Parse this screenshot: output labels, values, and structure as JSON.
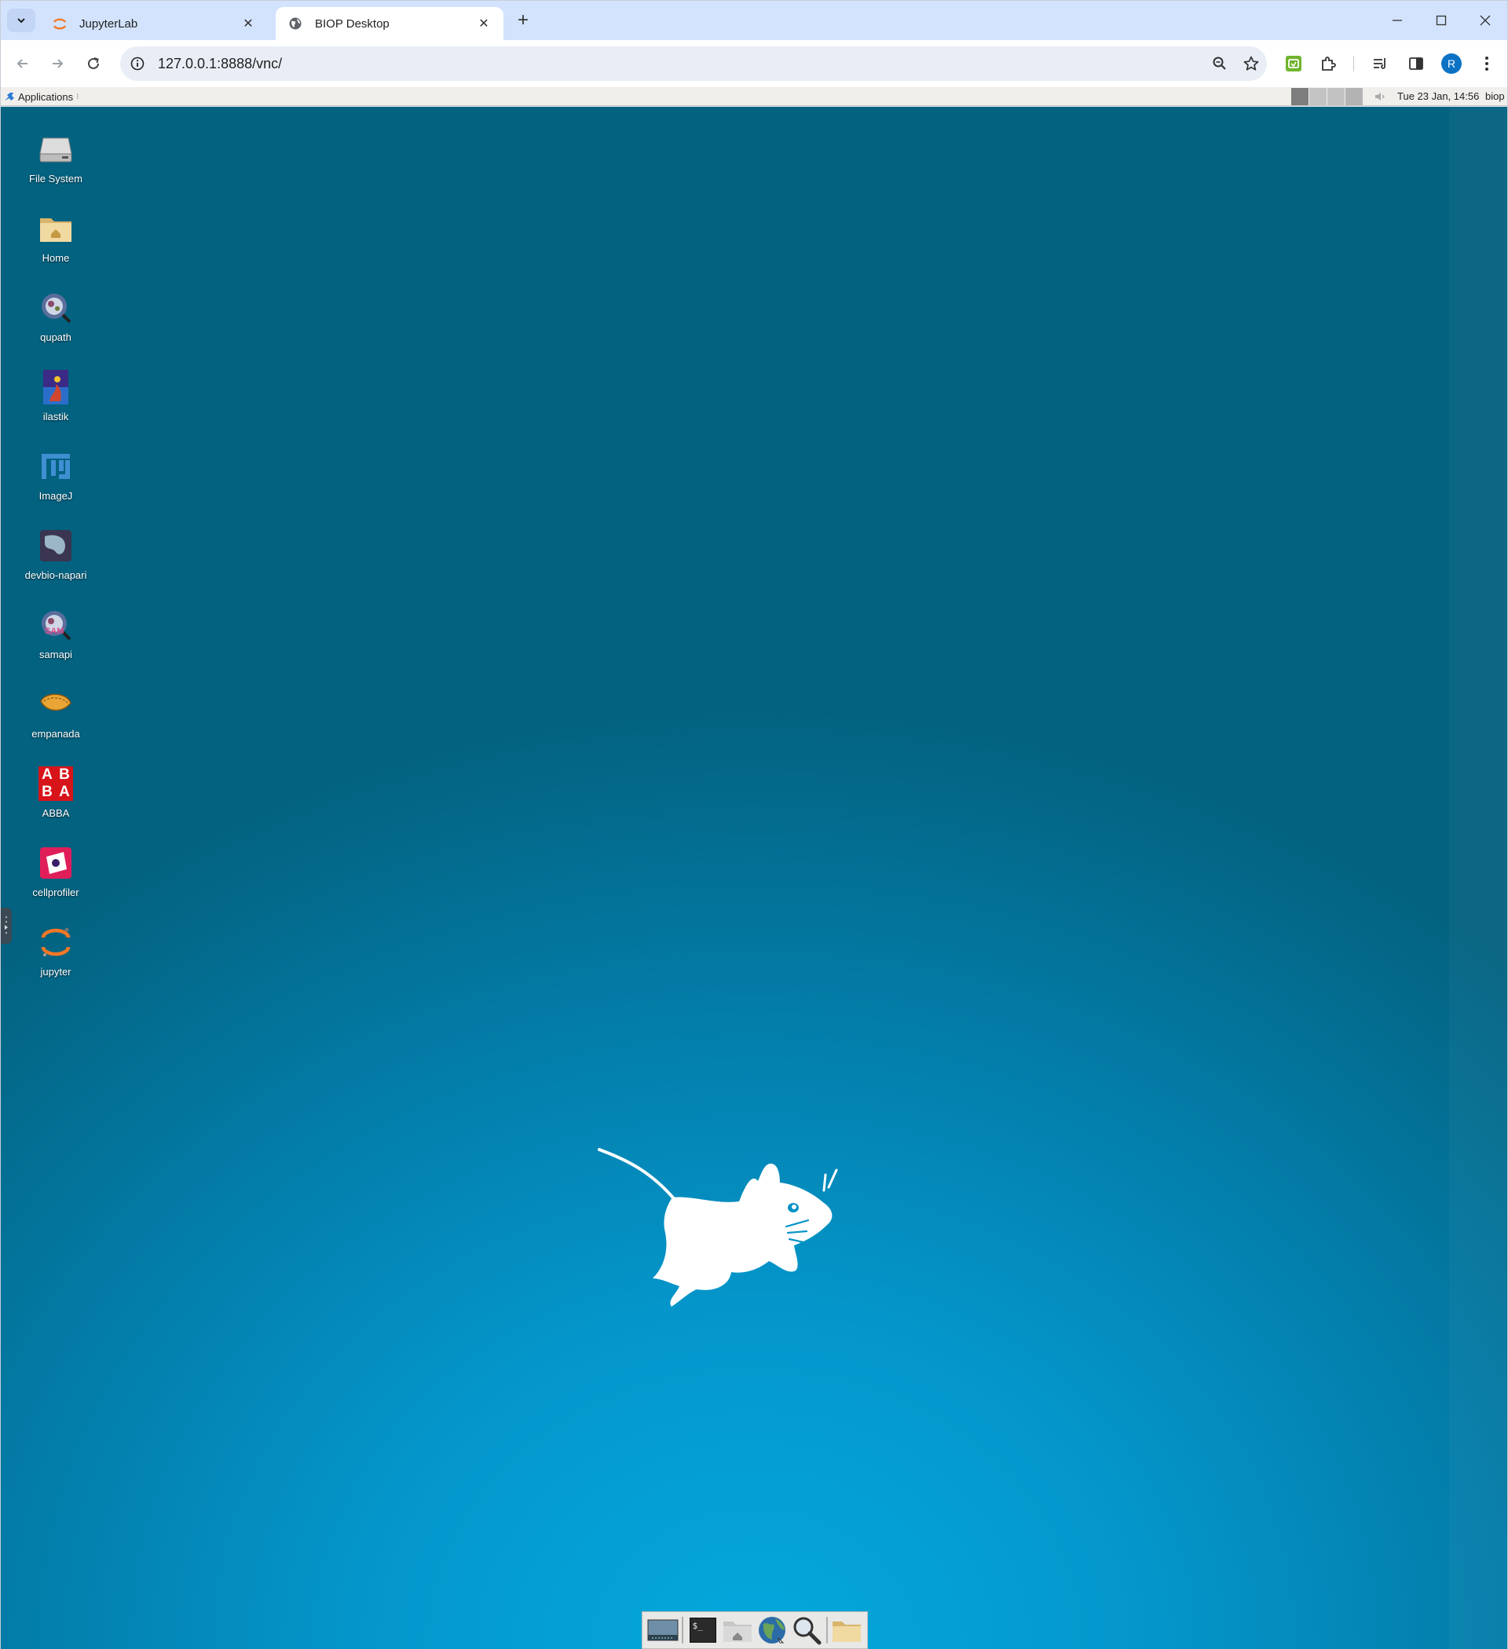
{
  "browser": {
    "tabs": [
      {
        "title": "JupyterLab",
        "active": false,
        "favicon": "jupyter-icon"
      },
      {
        "title": "BIOP Desktop",
        "active": true,
        "favicon": "globe-icon"
      }
    ],
    "address": "127.0.0.1:8888/vnc/",
    "profile_initial": "R"
  },
  "panel": {
    "applications_label": "Applications",
    "clock": "Tue 23 Jan, 14:56",
    "user": "biop"
  },
  "desktop": {
    "icons": [
      {
        "label": "File System",
        "icon": "drive-icon"
      },
      {
        "label": "Home",
        "icon": "home-folder-icon"
      },
      {
        "label": "qupath",
        "icon": "qupath-icon"
      },
      {
        "label": "ilastik",
        "icon": "ilastik-icon"
      },
      {
        "label": "ImageJ",
        "icon": "imagej-icon"
      },
      {
        "label": "devbio-napari",
        "icon": "napari-icon"
      },
      {
        "label": "samapi",
        "icon": "samapi-icon"
      },
      {
        "label": "empanada",
        "icon": "empanada-icon"
      },
      {
        "label": "ABBA",
        "icon": "abba-icon"
      },
      {
        "label": "cellprofiler",
        "icon": "cellprofiler-icon"
      },
      {
        "label": "jupyter",
        "icon": "jupyter-icon"
      }
    ],
    "abba_letters": [
      "A",
      "B",
      "B",
      "A"
    ],
    "samapi_overlay": "SAM",
    "dock": [
      "show-desktop-icon",
      "terminal-icon",
      "home-icon",
      "web-browser-icon",
      "search-icon",
      "folder-icon"
    ],
    "terminal_glyph": "$_"
  },
  "colors": {
    "tab_strip": "#d3e3fd",
    "desktop_top": "#036280",
    "desktop_bottom": "#04a8dc",
    "avatar": "#0b72c4"
  }
}
